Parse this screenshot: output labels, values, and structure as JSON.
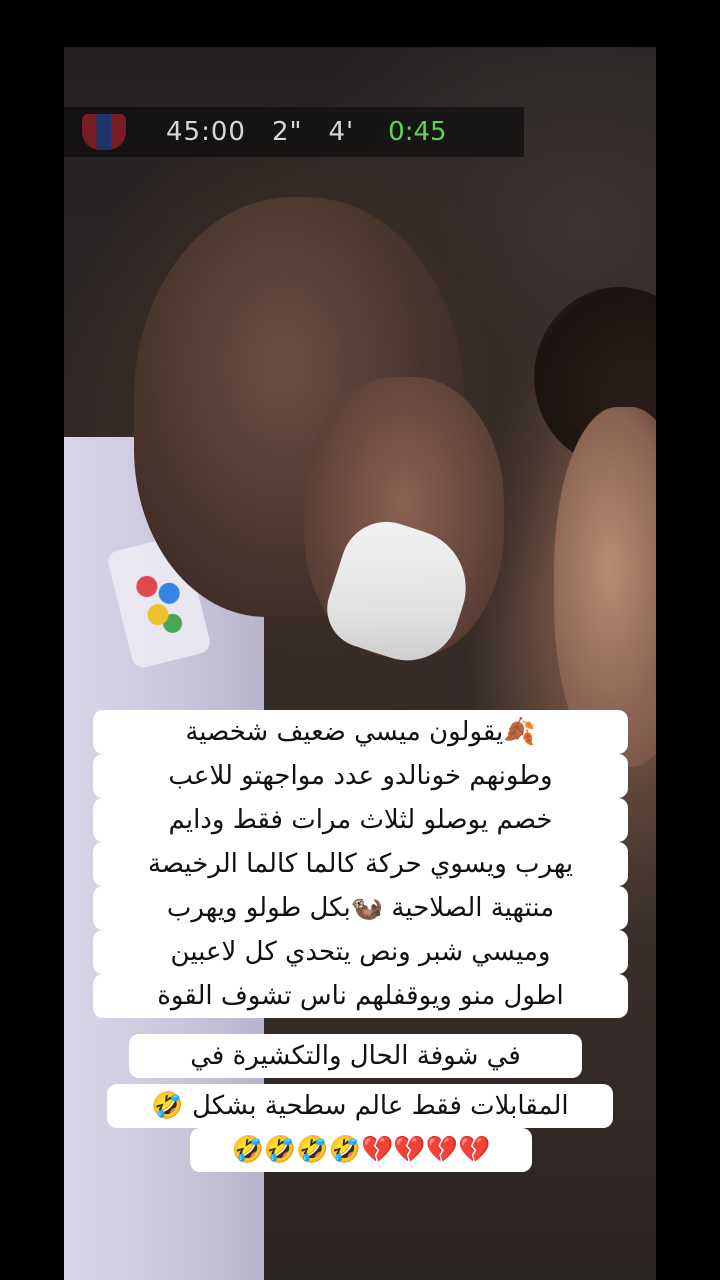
{
  "scoreboard": {
    "clock": "45:00",
    "extra": "2\"",
    "added": "4'",
    "elapsed": "0:45"
  },
  "caption": {
    "lines": [
      "🍂يقولون ميسي ضعيف شخصية",
      "وطونهم خونالدو عدد مواجهتو للاعب",
      "خصم يوصلو لثلاث مرات فقط ودايم",
      "يهرب ويسوي حركة كالما كالما الرخيصة",
      "منتهية الصلاحية 🦦بكل طولو ويهرب",
      "وميسي شبر ونص يتحدي كل لاعبين",
      "اطول منو ويوقفلهم ناس تشوف القوة",
      "في شوفة الحال والتكشيرة في",
      "المقابلات فقط عالم سطحية بشكل 🤣",
      "💔💔💔💔🤣🤣🤣🤣"
    ]
  }
}
